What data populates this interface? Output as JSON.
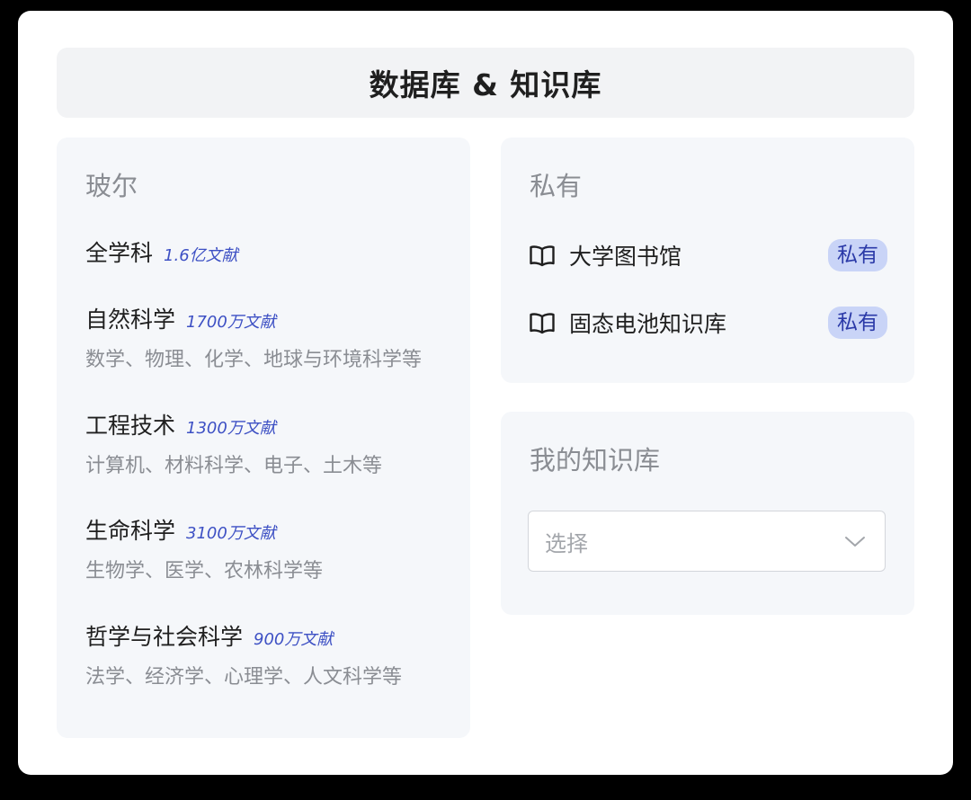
{
  "header": {
    "title": "数据库 & 知识库"
  },
  "bohr": {
    "heading": "玻尔",
    "items": [
      {
        "title": "全学科",
        "count": "1.6亿文献",
        "desc": ""
      },
      {
        "title": "自然科学",
        "count": "1700万文献",
        "desc": "数学、物理、化学、地球与环境科学等"
      },
      {
        "title": "工程技术",
        "count": "1300万文献",
        "desc": "计算机、材料科学、电子、土木等"
      },
      {
        "title": "生命科学",
        "count": "3100万文献",
        "desc": "生物学、医学、农林科学等"
      },
      {
        "title": "哲学与社会科学",
        "count": "900万文献",
        "desc": "法学、经济学、心理学、人文科学等"
      }
    ]
  },
  "private": {
    "heading": "私有",
    "items": [
      {
        "label": "大学图书馆",
        "badge": "私有",
        "icon": "book-open-icon"
      },
      {
        "label": "固态电池知识库",
        "badge": "私有",
        "icon": "book-open-icon"
      }
    ]
  },
  "my_kb": {
    "heading": "我的知识库",
    "select_placeholder": "选择",
    "icon": "chevron-down-icon"
  },
  "colors": {
    "accent": "#3d50c4",
    "badge_bg": "#c9d4f7",
    "badge_text": "#2b3aa8",
    "panel_bg": "#f5f7fa",
    "header_bg": "#f2f3f5"
  }
}
